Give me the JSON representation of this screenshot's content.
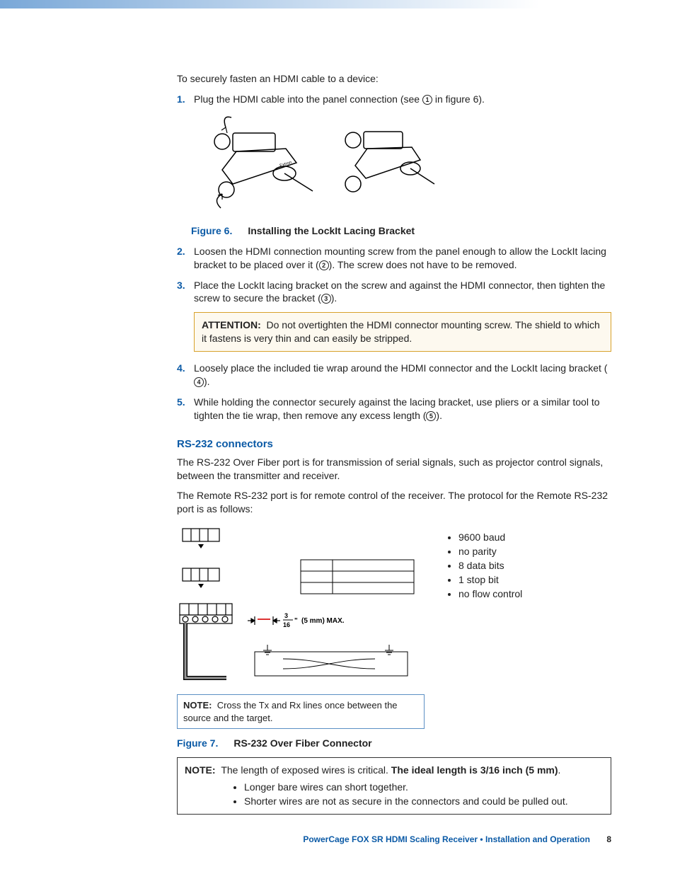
{
  "intro": "To securely fasten an HDMI cable to a device:",
  "steps": {
    "s1": {
      "n": "1.",
      "t_a": "Plug the HDMI cable into the panel connection (see ",
      "enc": "1",
      "t_b": " in figure 6)."
    },
    "s2": {
      "n": "2.",
      "t_a": "Loosen the HDMI connection mounting screw from the panel enough to allow the LockIt lacing bracket to be placed over it (",
      "enc": "2",
      "t_b": "). The screw does not have to be removed."
    },
    "s3": {
      "n": "3.",
      "t_a": "Place the LockIt lacing bracket on the screw and against the HDMI connector, then tighten the screw to secure the bracket (",
      "enc": "3",
      "t_b": ")."
    },
    "s4": {
      "n": "4.",
      "t_a": "Loosely place the included tie wrap around the HDMI connector and the LockIt lacing bracket (",
      "enc": "4",
      "t_b": ")."
    },
    "s5": {
      "n": "5.",
      "t_a": "While holding the connector securely against the lacing bracket, use pliers or a similar tool to tighten the tie wrap, then remove any excess length (",
      "enc": "5",
      "t_b": ")."
    }
  },
  "fig6": {
    "num": "Figure 6.",
    "title": "Installing the LockIt Lacing Bracket"
  },
  "attention": {
    "label": "ATTENTION:",
    "text": "Do not overtighten the HDMI connector mounting screw. The shield to which it fastens is very thin and can easily be stripped."
  },
  "rs232": {
    "heading": "RS-232 connectors",
    "p1": "The RS-232 Over Fiber port is for transmission of serial signals, such as projector control signals, between the transmitter and receiver.",
    "p2": "The Remote RS-232 port is for remote control of the receiver. The protocol for the Remote RS-232 port is as follows:",
    "specs": [
      "9600 baud",
      "no parity",
      "8 data bits",
      "1 stop bit",
      "no flow control"
    ],
    "strip_label": "(5 mm) MAX.",
    "strip_frac_top": "3",
    "strip_frac_bot": "16",
    "inner_note_label": "NOTE:",
    "inner_note_text": "Cross the Tx and Rx lines once between the source and the target."
  },
  "fig7": {
    "num": "Figure 7.",
    "title": "RS-232 Over Fiber Connector"
  },
  "big_note": {
    "label": "NOTE:",
    "lead_a": "The length of exposed wires is critical. ",
    "lead_b": "The ideal length is 3/16 inch (5 mm)",
    "lead_c": ".",
    "bullets": [
      "Longer bare wires can short together.",
      "Shorter wires are not as secure in the connectors and could be pulled out."
    ]
  },
  "footer": {
    "title": "PowerCage FOX SR HDMI Scaling Receiver • Installation and Operation",
    "page": "8"
  }
}
